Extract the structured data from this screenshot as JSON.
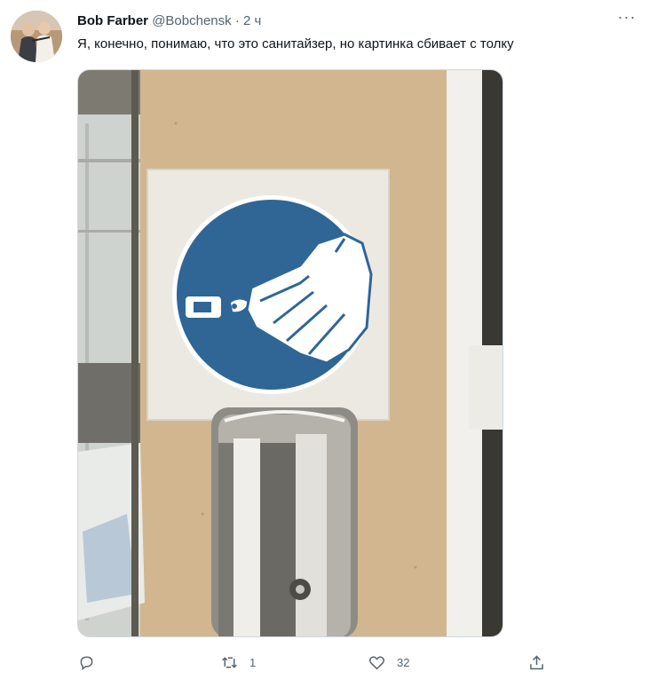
{
  "author": {
    "name": "Bob Farber",
    "handle": "@Bobchensk",
    "separator": "·",
    "time": "2 ч"
  },
  "more_icon": "more-horizontal-icon",
  "tweet_text": "Я, конечно, понимаю, что это санитайзер, но картинка сбивает с толку",
  "media": {
    "kind": "photo",
    "description_icon": "hand-sanitizer-sign",
    "colors": {
      "sign_blue": "#2f6696",
      "wall": "#cdb08a",
      "frame": "#ece9e2"
    }
  },
  "actions": {
    "reply": {
      "icon": "reply-icon",
      "count": ""
    },
    "retweet": {
      "icon": "retweet-icon",
      "count": "1"
    },
    "like": {
      "icon": "heart-icon",
      "count": "32"
    },
    "share": {
      "icon": "share-icon"
    }
  },
  "colors": {
    "text": "#0f1419",
    "secondary": "#536471",
    "border": "#cfd9de"
  }
}
